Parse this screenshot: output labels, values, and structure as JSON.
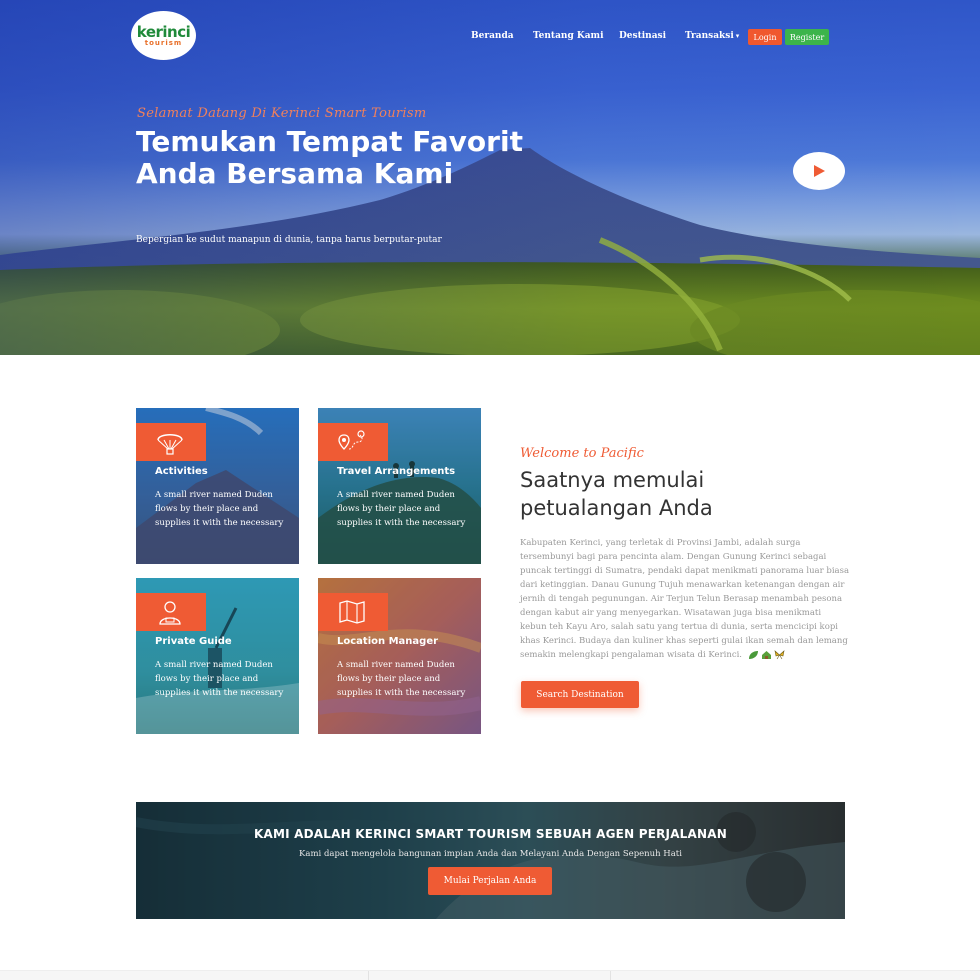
{
  "logo": {
    "top": "kerinci",
    "bottom": "tourism"
  },
  "nav": {
    "items": [
      "Beranda",
      "Tentang Kami",
      "Destinasi",
      "Transaksi"
    ],
    "login": "Login",
    "register": "Register"
  },
  "hero": {
    "script": "Selamat Datang Di Kerinci Smart Tourism",
    "title": "Temukan Tempat Favorit Anda Bersama Kami",
    "subtitle": "Bepergian ke sudut manapun di dunia, tanpa harus berputar-putar"
  },
  "services": [
    {
      "title": "Activities",
      "text": "A small river named Duden flows by their place and supplies it with the necessary",
      "icon": "parachute-icon"
    },
    {
      "title": "Travel Arrangements",
      "text": "A small river named Duden flows by their place and supplies it with the necessary",
      "icon": "route-pin-icon"
    },
    {
      "title": "Private Guide",
      "text": "A small river named Duden flows by their place and supplies it with the necessary",
      "icon": "guide-person-icon"
    },
    {
      "title": "Location Manager",
      "text": "A small river named Duden flows by their place and supplies it with the necessary",
      "icon": "map-icon"
    }
  ],
  "welcome": {
    "script": "Welcome to Pacific",
    "title": "Saatnya memulai petualangan Anda",
    "paragraph": "Kabupaten Kerinci, yang terletak di Provinsi Jambi, adalah surga tersembunyi bagi para pencinta alam. Dengan Gunung Kerinci sebagai puncak tertinggi di Sumatra, pendaki dapat menikmati panorama luar biasa dari ketinggian. Danau Gunung Tujuh menawarkan ketenangan dengan air jernih di tengah pegunungan. Air Terjun Telun Berasap menambah pesona dengan kabut air yang menyegarkan. Wisatawan juga bisa menikmati kebun teh Kayu Aro, salah satu yang tertua di dunia, serta mencicipi kopi khas Kerinci. Budaya dan kuliner khas seperti gulai ikan semah dan lemang semakin melengkapi pengalaman wisata di Kerinci.",
    "button": "Search Destination"
  },
  "banner": {
    "title": "KAMI ADALAH KERINCI SMART TOURISM SEBUAH AGEN PERJALANAN",
    "subtitle": "Kami dapat mengelola bangunan impian Anda dan Melayani Anda Dengan Sepenuh Hati",
    "button": "Mulai Perjalan Anda"
  },
  "colors": {
    "accent": "#ef5b34",
    "register": "#3cb44b",
    "hero_blue": "#3a63d2"
  }
}
